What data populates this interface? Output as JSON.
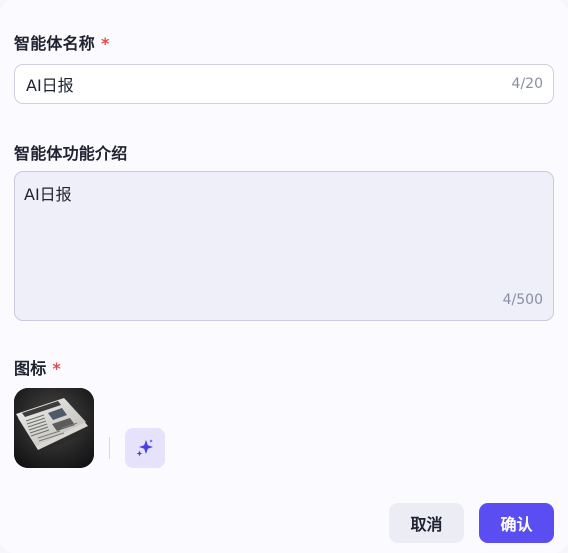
{
  "form": {
    "name": {
      "label": "智能体名称",
      "required_mark": "*",
      "value": "AI日报",
      "counter": "4/20"
    },
    "description": {
      "label": "智能体功能介绍",
      "value": "AI日报",
      "counter": "4/500"
    },
    "icon": {
      "label": "图标",
      "required_mark": "*",
      "image_name": "newspaper-image",
      "ai_generate_icon": "sparkle-icon"
    }
  },
  "actions": {
    "cancel_label": "取消",
    "confirm_label": "确认"
  },
  "colors": {
    "accent": "#5a4df2",
    "required": "#e5484d",
    "ai_button_bg": "#e6e2fb"
  }
}
